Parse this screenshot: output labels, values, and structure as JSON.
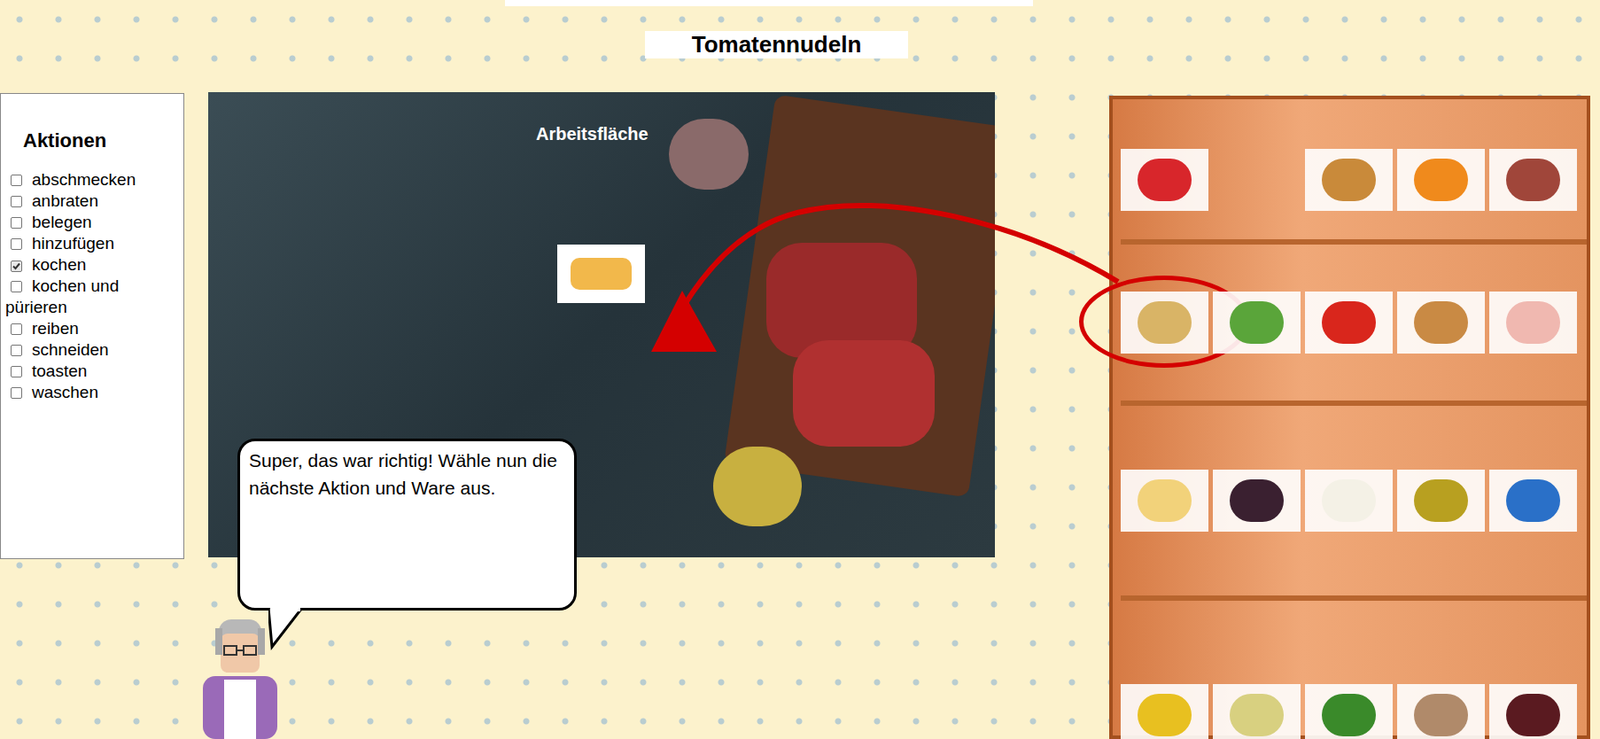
{
  "title": "Tomatennudeln",
  "actions_panel": {
    "heading": "Aktionen",
    "items": [
      {
        "label": "abschmecken",
        "checked": false
      },
      {
        "label": "anbraten",
        "checked": false
      },
      {
        "label": "belegen",
        "checked": false
      },
      {
        "label": "hinzufügen",
        "checked": false
      },
      {
        "label": "kochen",
        "checked": true
      },
      {
        "label": "kochen und pürieren",
        "checked": false
      },
      {
        "label": "reiben",
        "checked": false
      },
      {
        "label": "schneiden",
        "checked": false
      },
      {
        "label": "toasten",
        "checked": false
      },
      {
        "label": "waschen",
        "checked": false
      }
    ]
  },
  "workspace": {
    "label": "Arbeitsfläche",
    "items": [
      {
        "color": "#f2b84b"
      }
    ]
  },
  "speech_bubble": {
    "text": "Super, das war richtig! Wähle nun die nächste Aktion und Ware aus."
  },
  "shelf": {
    "rows": [
      [
        {
          "color": "#d8262b",
          "selected": false
        },
        {
          "color": "#c98a3a",
          "selected": false
        },
        {
          "color": "#f08a1c",
          "selected": false
        },
        {
          "color": "#a0463a",
          "selected": false
        }
      ],
      [
        {
          "color": "#d9b466",
          "selected": true
        },
        {
          "color": "#5aa53a",
          "selected": false
        },
        {
          "color": "#d9261c",
          "selected": false
        },
        {
          "color": "#c98a44",
          "selected": false
        },
        {
          "color": "#f0b8b0",
          "selected": false
        }
      ],
      [
        {
          "color": "#f2d27a",
          "selected": false
        },
        {
          "color": "#3a2030",
          "selected": false
        },
        {
          "color": "#f4f1e6",
          "selected": false
        },
        {
          "color": "#b8a020",
          "selected": false
        },
        {
          "color": "#2a70c8",
          "selected": false
        }
      ],
      [
        {
          "color": "#e8c020",
          "selected": false
        },
        {
          "color": "#d8d080",
          "selected": false
        },
        {
          "color": "#3a8a2a",
          "selected": false
        },
        {
          "color": "#b08a6a",
          "selected": false
        },
        {
          "color": "#5a1a20",
          "selected": false
        }
      ]
    ]
  }
}
